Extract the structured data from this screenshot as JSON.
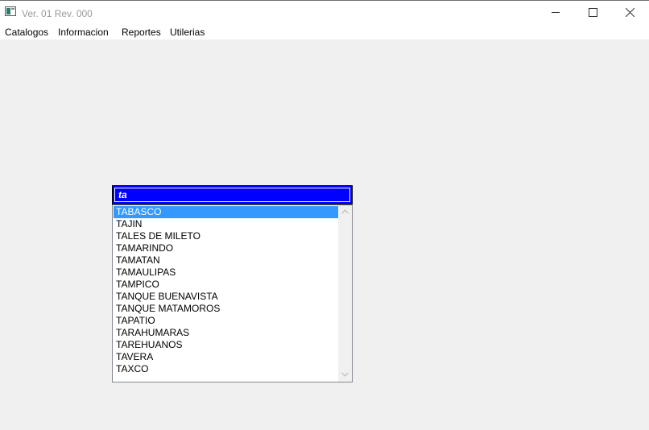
{
  "window": {
    "title": "Ver. 01 Rev. 000",
    "controls": [
      "minimize-icon",
      "maximize-icon",
      "close-icon"
    ]
  },
  "menu": {
    "items": [
      "Catalogos",
      "Informacion",
      "Reportes",
      "Utilerias"
    ]
  },
  "search": {
    "value": "ta"
  },
  "list": {
    "items": [
      "TABASCO",
      "TAJIN",
      "TALES DE MILETO",
      "TAMARINDO",
      "TAMATAN",
      "TAMAULIPAS",
      "TAMPICO",
      "TANQUE BUENAVISTA",
      "TANQUE MATAMOROS",
      "TAPATIO",
      "TARAHUMARAS",
      "TAREHUANOS",
      "TAVERA",
      "TAXCO"
    ],
    "selected_item": "TABASCO"
  },
  "colors": {
    "search_background": "#0000ff",
    "selection": "#3399ff"
  }
}
